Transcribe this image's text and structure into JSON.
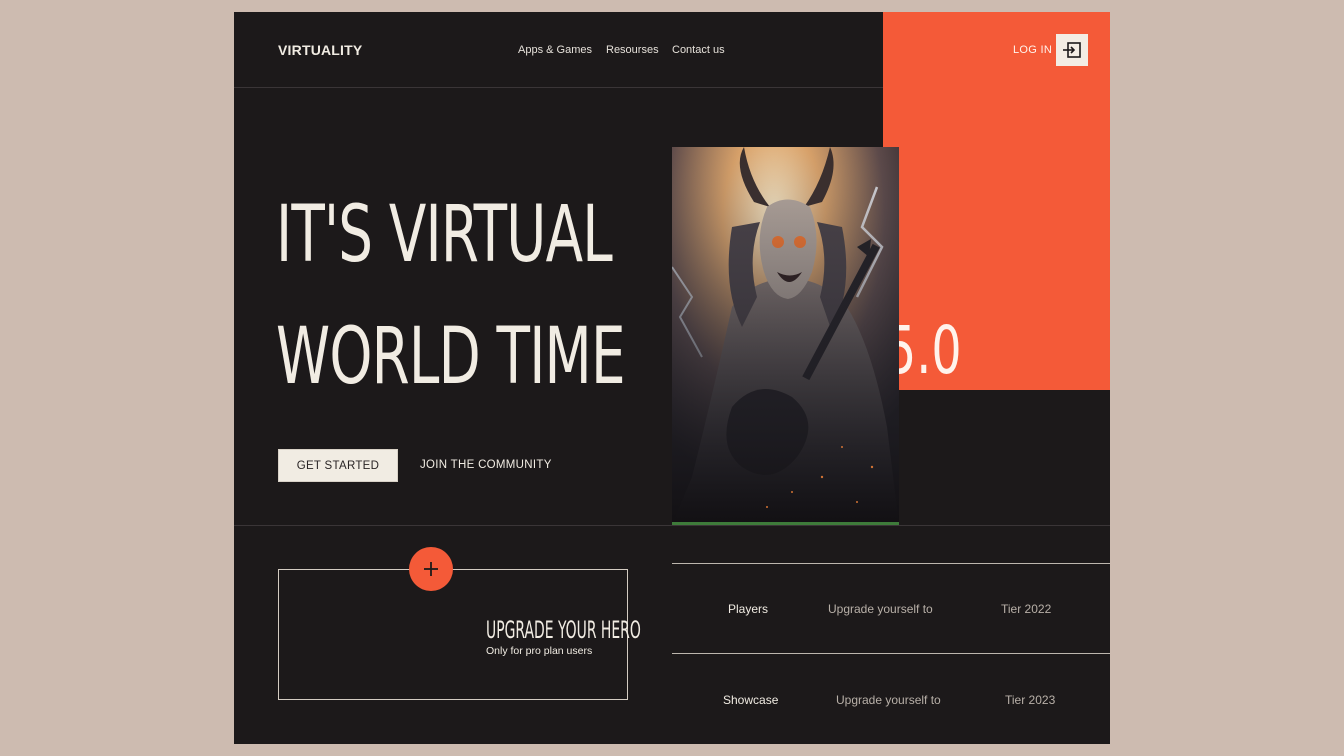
{
  "header": {
    "brand": "VIRTUALITY",
    "nav": [
      "Apps & Games",
      "Resourses",
      "Contact us"
    ],
    "login_label": "LOG IN"
  },
  "hero": {
    "title_line1": "IT'S VIRTUAL",
    "title_line2": "WORLD TIME",
    "big_number": "5.0",
    "cta_primary": "GET STARTED",
    "cta_secondary": "JOIN THE COMMUNITY"
  },
  "upgrade_card": {
    "title": "UPGRADE YOUR HERO",
    "subtitle": "Only for pro plan users"
  },
  "rows": [
    {
      "label": "Players",
      "text": "Upgrade yourself to",
      "tier": "Tier 2022"
    },
    {
      "label": "Showcase",
      "text": "Upgrade yourself to",
      "tier": "Tier 2023"
    }
  ],
  "colors": {
    "accent": "#f45a38",
    "background": "#1c191a",
    "cream": "#f1ece3",
    "page_bg": "#cdbbb0"
  },
  "icons": {
    "login": "login-arrow-icon",
    "plus": "plus-icon"
  }
}
